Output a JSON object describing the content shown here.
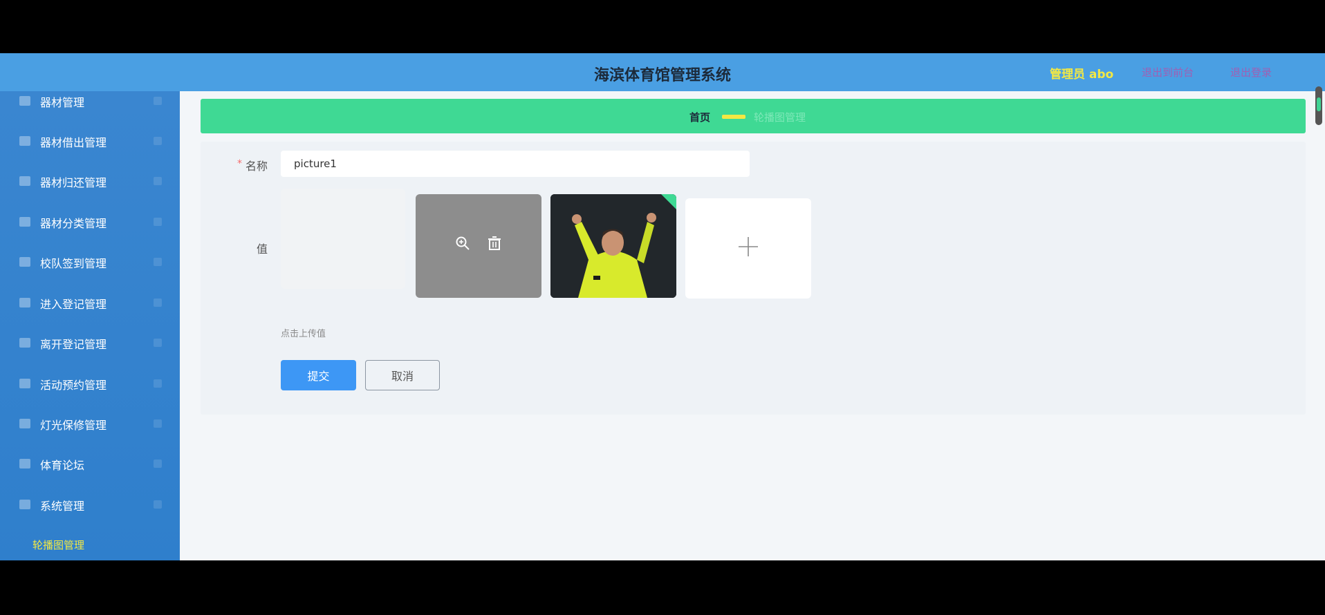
{
  "header": {
    "title": "海滨体育馆管理系统",
    "admin": "管理员 abo",
    "link_home": "退出到前台",
    "link_logout": "退出登录"
  },
  "sidebar": {
    "items": [
      {
        "label": "器材管理"
      },
      {
        "label": "器材借出管理"
      },
      {
        "label": "器材归还管理"
      },
      {
        "label": "器材分类管理"
      },
      {
        "label": "校队签到管理"
      },
      {
        "label": "进入登记管理"
      },
      {
        "label": "离开登记管理"
      },
      {
        "label": "活动预约管理"
      },
      {
        "label": "灯光保修管理"
      },
      {
        "label": "体育论坛"
      },
      {
        "label": "系统管理"
      }
    ],
    "active_sub": "轮播图管理"
  },
  "breadcrumb": {
    "home": "首页",
    "current": "轮播图管理"
  },
  "form": {
    "name_label": "名称",
    "name_value": "picture1",
    "value_label": "值",
    "upload_tip": "点击上传值",
    "submit_label": "提交",
    "cancel_label": "取消"
  },
  "colors": {
    "header_bg": "#4a9fe3",
    "sidebar_bg": "#2f7fcc",
    "breadcrumb_bg": "#3fd994",
    "accent_yellow": "#f3e843",
    "primary_button": "#3d97f5"
  }
}
